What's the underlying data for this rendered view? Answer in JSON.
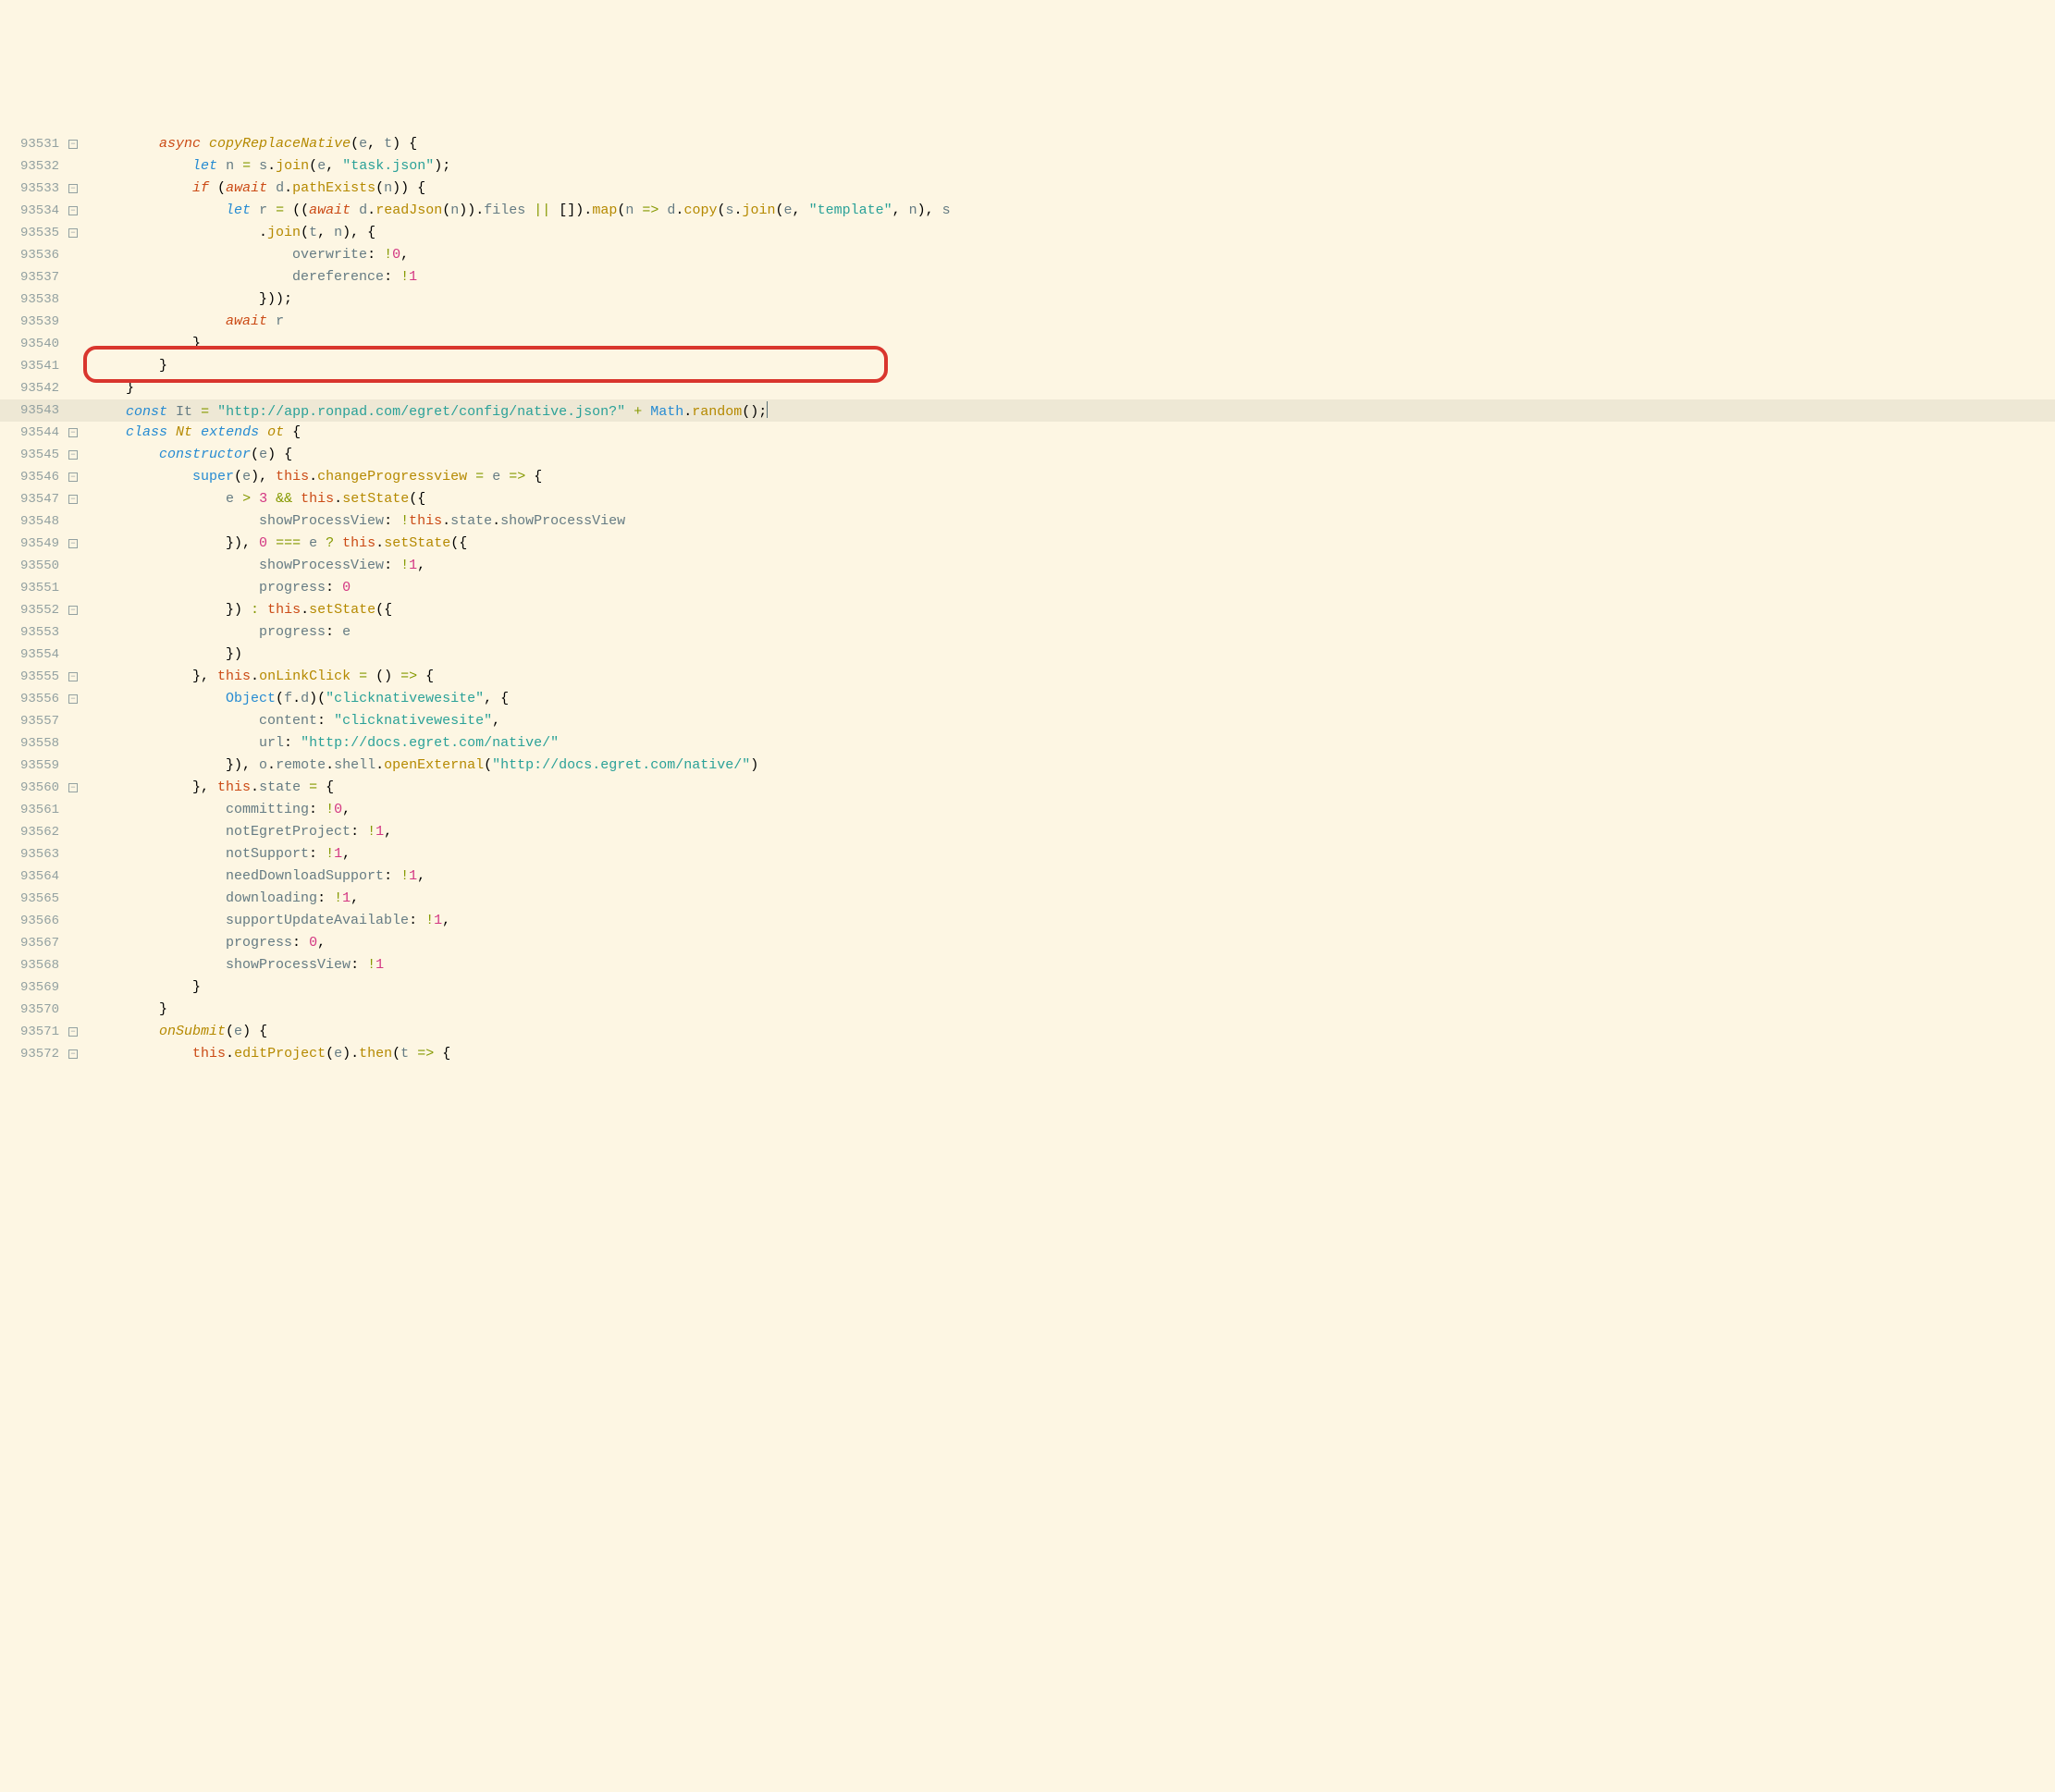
{
  "lines": [
    {
      "ln": "93531",
      "fold": true,
      "html": "        <span class=c-kw2>async</span> <span class=c-fn>copyReplaceNative</span>(<span class=c-ident>e</span>, <span class=c-ident>t</span>) {"
    },
    {
      "ln": "93532",
      "fold": false,
      "html": "            <span class=c-kw>let</span> <span class=c-ident>n</span> <span class=c-op>=</span> <span class=c-ident>s</span>.<span class=c-method>join</span>(<span class=c-ident>e</span>, <span class=c-str>\"task.json\"</span>);"
    },
    {
      "ln": "93533",
      "fold": true,
      "html": "            <span class=c-kw2>if</span> (<span class=c-kw2>await</span> <span class=c-ident>d</span>.<span class=c-method>pathExists</span>(<span class=c-ident>n</span>)) {"
    },
    {
      "ln": "93534",
      "fold": true,
      "html": "                <span class=c-kw>let</span> <span class=c-ident>r</span> <span class=c-op>=</span> ((<span class=c-kw2>await</span> <span class=c-ident>d</span>.<span class=c-method>readJson</span>(<span class=c-ident>n</span>)).<span class=c-ident>files</span> <span class=c-op>||</span> []).<span class=c-method>map</span>(<span class=c-ident>n</span> <span class=c-op>=&gt;</span> <span class=c-ident>d</span>.<span class=c-method>copy</span>(<span class=c-ident>s</span>.<span class=c-method>join</span>(<span class=c-ident>e</span>, <span class=c-str>\"template\"</span>, <span class=c-ident>n</span>), <span class=c-ident>s</span>"
    },
    {
      "ln": "93535",
      "fold": true,
      "html": "                    .<span class=c-method>join</span>(<span class=c-ident>t</span>, <span class=c-ident>n</span>), {"
    },
    {
      "ln": "93536",
      "fold": false,
      "html": "                        <span class=c-ident>overwrite</span>: <span class=c-op>!</span><span class=c-num>0</span>,"
    },
    {
      "ln": "93537",
      "fold": false,
      "html": "                        <span class=c-ident>dereference</span>: <span class=c-op>!</span><span class=c-num>1</span>"
    },
    {
      "ln": "93538",
      "fold": false,
      "html": "                    }));"
    },
    {
      "ln": "93539",
      "fold": false,
      "html": "                <span class=c-kw2>await</span> <span class=c-ident>r</span>"
    },
    {
      "ln": "93540",
      "fold": false,
      "html": "            }"
    },
    {
      "ln": "93541",
      "fold": false,
      "html": "        }"
    },
    {
      "ln": "93542",
      "fold": false,
      "html": "    }"
    },
    {
      "ln": "93543",
      "fold": false,
      "hi": true,
      "html": "    <span class=c-kw>const</span> <span class=c-ident>It</span> <span class=c-op>=</span> <span class=c-str>\"http://app.ronpad.com/egret/config/native.json?\"</span> <span class=c-op>+</span> <span class=c-obj>Math</span>.<span class=c-method>random</span>();<span class=cursor></span>"
    },
    {
      "ln": "93544",
      "fold": true,
      "html": "    <span class=c-kw>class</span> <span class=c-fn>Nt</span> <span class=c-kw>extends</span> <span class=c-fn>ot</span> {"
    },
    {
      "ln": "93545",
      "fold": true,
      "html": "        <span class=c-kw>constructor</span>(<span class=c-ident>e</span>) {"
    },
    {
      "ln": "93546",
      "fold": true,
      "html": "            <span class=c-obj>super</span>(<span class=c-ident>e</span>), <span class=c-thisn>this</span>.<span class=c-method>changeProgressview</span> <span class=c-op>=</span> <span class=c-ident>e</span> <span class=c-op>=&gt;</span> {"
    },
    {
      "ln": "93547",
      "fold": true,
      "html": "                <span class=c-ident>e</span> <span class=c-op>&gt;</span> <span class=c-num>3</span> <span class=c-op>&amp;&amp;</span> <span class=c-thisn>this</span>.<span class=c-method>setState</span>({"
    },
    {
      "ln": "93548",
      "fold": false,
      "html": "                    <span class=c-ident>showProcessView</span>: <span class=c-op>!</span><span class=c-thisn>this</span>.<span class=c-ident>state</span>.<span class=c-ident>showProcessView</span>"
    },
    {
      "ln": "93549",
      "fold": true,
      "html": "                }), <span class=c-num>0</span> <span class=c-op>===</span> <span class=c-ident>e</span> <span class=c-op>?</span> <span class=c-thisn>this</span>.<span class=c-method>setState</span>({"
    },
    {
      "ln": "93550",
      "fold": false,
      "html": "                    <span class=c-ident>showProcessView</span>: <span class=c-op>!</span><span class=c-num>1</span>,"
    },
    {
      "ln": "93551",
      "fold": false,
      "html": "                    <span class=c-ident>progress</span>: <span class=c-num>0</span>"
    },
    {
      "ln": "93552",
      "fold": true,
      "html": "                }) <span class=c-op>:</span> <span class=c-thisn>this</span>.<span class=c-method>setState</span>({"
    },
    {
      "ln": "93553",
      "fold": false,
      "html": "                    <span class=c-ident>progress</span>: <span class=c-ident>e</span>"
    },
    {
      "ln": "93554",
      "fold": false,
      "html": "                })"
    },
    {
      "ln": "93555",
      "fold": true,
      "html": "            }, <span class=c-thisn>this</span>.<span class=c-method>onLinkClick</span> <span class=c-op>=</span> () <span class=c-op>=&gt;</span> {"
    },
    {
      "ln": "93556",
      "fold": true,
      "html": "                <span class=c-obj>Object</span>(<span class=c-ident>f</span>.<span class=c-ident>d</span>)(<span class=c-str>\"clicknativewesite\"</span>, {"
    },
    {
      "ln": "93557",
      "fold": false,
      "html": "                    <span class=c-ident>content</span>: <span class=c-str>\"clicknativewesite\"</span>,"
    },
    {
      "ln": "93558",
      "fold": false,
      "html": "                    <span class=c-ident>url</span>: <span class=c-str>\"http://docs.egret.com/native/\"</span>"
    },
    {
      "ln": "93559",
      "fold": false,
      "html": "                }), <span class=c-ident>o</span>.<span class=c-ident>remote</span>.<span class=c-ident>shell</span>.<span class=c-method>openExternal</span>(<span class=c-str>\"http://docs.egret.com/native/\"</span>)"
    },
    {
      "ln": "93560",
      "fold": true,
      "html": "            }, <span class=c-thisn>this</span>.<span class=c-ident>state</span> <span class=c-op>=</span> {"
    },
    {
      "ln": "93561",
      "fold": false,
      "html": "                <span class=c-ident>committing</span>: <span class=c-op>!</span><span class=c-num>0</span>,"
    },
    {
      "ln": "93562",
      "fold": false,
      "html": "                <span class=c-ident>notEgretProject</span>: <span class=c-op>!</span><span class=c-num>1</span>,"
    },
    {
      "ln": "93563",
      "fold": false,
      "html": "                <span class=c-ident>notSupport</span>: <span class=c-op>!</span><span class=c-num>1</span>,"
    },
    {
      "ln": "93564",
      "fold": false,
      "html": "                <span class=c-ident>needDownloadSupport</span>: <span class=c-op>!</span><span class=c-num>1</span>,"
    },
    {
      "ln": "93565",
      "fold": false,
      "html": "                <span class=c-ident>downloading</span>: <span class=c-op>!</span><span class=c-num>1</span>,"
    },
    {
      "ln": "93566",
      "fold": false,
      "html": "                <span class=c-ident>supportUpdateAvailable</span>: <span class=c-op>!</span><span class=c-num>1</span>,"
    },
    {
      "ln": "93567",
      "fold": false,
      "html": "                <span class=c-ident>progress</span>: <span class=c-num>0</span>,"
    },
    {
      "ln": "93568",
      "fold": false,
      "html": "                <span class=c-ident>showProcessView</span>: <span class=c-op>!</span><span class=c-num>1</span>"
    },
    {
      "ln": "93569",
      "fold": false,
      "html": "            }"
    },
    {
      "ln": "93570",
      "fold": false,
      "html": "        }"
    },
    {
      "ln": "93571",
      "fold": true,
      "html": "        <span class=c-fn>onSubmit</span>(<span class=c-ident>e</span>) {"
    },
    {
      "ln": "93572",
      "fold": true,
      "html": "            <span class=c-thisn>this</span>.<span class=c-method>editProject</span>(<span class=c-ident>e</span>).<span class=c-method>then</span>(<span class=c-ident>t</span> <span class=c-op>=&gt;</span> {"
    }
  ],
  "highlight_line": "93543"
}
